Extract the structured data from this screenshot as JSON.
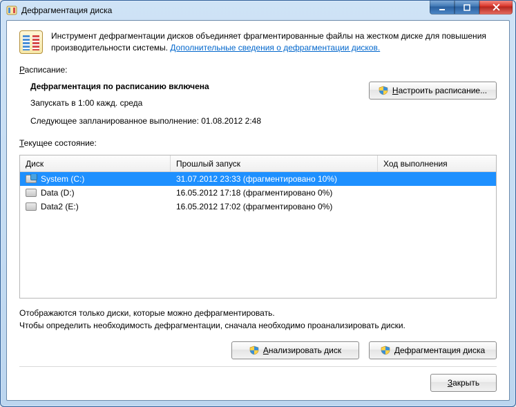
{
  "window": {
    "title": "Дефрагментация диска"
  },
  "intro": {
    "text": "Инструмент дефрагментации дисков объединяет фрагментированные файлы на жестком диске для повышения производительности системы. ",
    "link": "Дополнительные сведения о дефрагментации дисков."
  },
  "schedule": {
    "label_prefix": "Р",
    "label_rest": "асписание:",
    "enabled_heading": "Дефрагментация по расписанию включена",
    "run_at": "Запускать в 1:00 кажд. среда",
    "next_run": "Следующее запланированное выполнение: 01.08.2012 2:48",
    "configure_prefix": "Н",
    "configure_rest": "астроить расписание..."
  },
  "status": {
    "label_prefix": "Т",
    "label_rest": "екущее состояние:"
  },
  "table": {
    "headers": {
      "disk": "Диск",
      "last": "Прошлый запуск",
      "progress": "Ход выполнения"
    },
    "rows": [
      {
        "name": "System (C:)",
        "last": "31.07.2012 23:33 (фрагментировано 10%)",
        "progress": "",
        "selected": true,
        "system": true
      },
      {
        "name": "Data (D:)",
        "last": "16.05.2012 17:18 (фрагментировано 0%)",
        "progress": "",
        "selected": false,
        "system": false
      },
      {
        "name": "Data2 (E:)",
        "last": "16.05.2012 17:02 (фрагментировано 0%)",
        "progress": "",
        "selected": false,
        "system": false
      }
    ]
  },
  "hints": {
    "line1": "Отображаются только диски, которые можно дефрагментировать.",
    "line2": "Чтобы определить необходимость  дефрагментации, сначала необходимо проанализировать диски."
  },
  "buttons": {
    "analyze_prefix": "А",
    "analyze_rest": "нализировать диск",
    "defrag_prefix": "Д",
    "defrag_rest": "ефрагментация диска",
    "close_prefix": "З",
    "close_rest": "акрыть"
  }
}
